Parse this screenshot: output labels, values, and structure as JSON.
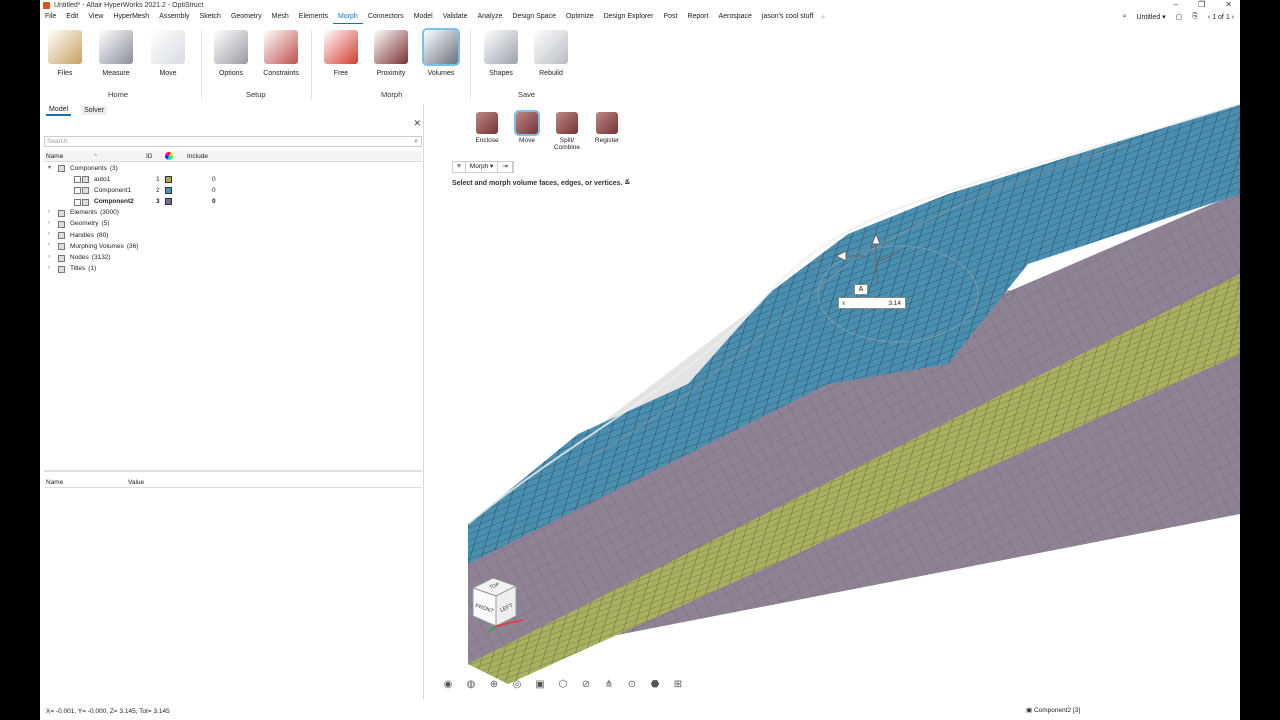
{
  "window": {
    "title": "Untitled* - Altair HyperWorks 2021.2 - OptiStruct"
  },
  "menu": {
    "items": [
      "File",
      "Edit",
      "View",
      "HyperMesh",
      "Assembly",
      "Sketch",
      "Geometry",
      "Mesh",
      "Elements",
      "Morph",
      "Connectors",
      "Model",
      "Validate",
      "Analyze",
      "Design Space",
      "Optimize",
      "Design Explorer",
      "Post",
      "Report",
      "Aerospace",
      "jason's cool stuff"
    ],
    "active": "Morph",
    "right": {
      "session": "Untitled",
      "pages": "1 of 1"
    }
  },
  "ribbon": {
    "tools": [
      {
        "label": "Files",
        "icon": "files-icon",
        "color": "#c8a060"
      },
      {
        "label": "Measure",
        "icon": "measure-icon",
        "color": "#8a8e98"
      },
      {
        "label": "Move",
        "icon": "move-icon",
        "color": "#d8dce2"
      },
      {
        "label": "Options",
        "icon": "options-icon",
        "color": "#9a9aa2"
      },
      {
        "label": "Constraints",
        "icon": "constraints-icon",
        "color": "#c05050"
      },
      {
        "label": "Free",
        "icon": "free-icon",
        "color": "#d43a30"
      },
      {
        "label": "Proximity",
        "icon": "proximity-icon",
        "color": "#7a3030"
      },
      {
        "label": "Volumes",
        "icon": "volumes-icon",
        "color": "#6a7280"
      },
      {
        "label": "Shapes",
        "icon": "shapes-icon",
        "color": "#9ca2aa"
      },
      {
        "label": "Rebuild",
        "icon": "rebuild-icon",
        "color": "#b8bcc2"
      }
    ],
    "groups": [
      "Home",
      "Setup",
      "Morph",
      "Save"
    ]
  },
  "panel": {
    "tabs": [
      "Model",
      "Solver"
    ],
    "search_placeholder": "Search",
    "columns": {
      "name": "Name",
      "id": "ID",
      "include": "Include"
    },
    "tree": [
      {
        "label": "Components",
        "count": "(3)",
        "level": 0,
        "expanded": true
      },
      {
        "label": "auto1",
        "id": "1",
        "include": "0",
        "color": "#a8a860",
        "level": 1
      },
      {
        "label": "Component1",
        "id": "2",
        "include": "0",
        "color": "#4a9ab8",
        "level": 1
      },
      {
        "label": "Component2",
        "id": "3",
        "include": "0",
        "color": "#7a6a8a",
        "level": 1,
        "bold": true
      },
      {
        "label": "Elements",
        "count": "(3000)",
        "level": 0
      },
      {
        "label": "Geometry",
        "count": "(5)",
        "level": 0
      },
      {
        "label": "Handles",
        "count": "(80)",
        "level": 0
      },
      {
        "label": "Morphing Volumes",
        "count": "(36)",
        "level": 0
      },
      {
        "label": "Nodes",
        "count": "(3132)",
        "level": 0
      },
      {
        "label": "Titles",
        "count": "(1)",
        "level": 0
      }
    ],
    "props": {
      "name": "Name",
      "value": "Value"
    }
  },
  "subtools": [
    {
      "label": "Enclose",
      "icon": "enclose-icon"
    },
    {
      "label": "Move",
      "icon": "move-volume-icon"
    },
    {
      "label": "Split/ Combine",
      "icon": "split-combine-icon"
    },
    {
      "label": "Register",
      "icon": "register-icon"
    }
  ],
  "minibar": {
    "menu": "Morph"
  },
  "prompt": "Select and morph volume faces, edges, or vertices.",
  "input": {
    "axis": "x",
    "value": "3.14"
  },
  "viewcube": {
    "top": "TOP",
    "front": "FRONT",
    "left": "LEFT"
  },
  "status": {
    "coords": "X= -0.001, Y= -0.000, Z= 3.145, Tot= 3.145",
    "selection": "Component2 [3]"
  },
  "colors": {
    "mesh_blue": "#4a8fb0",
    "mesh_purple": "#8e8294",
    "mesh_olive": "#a9b060",
    "accent": "#1a6fb5"
  }
}
